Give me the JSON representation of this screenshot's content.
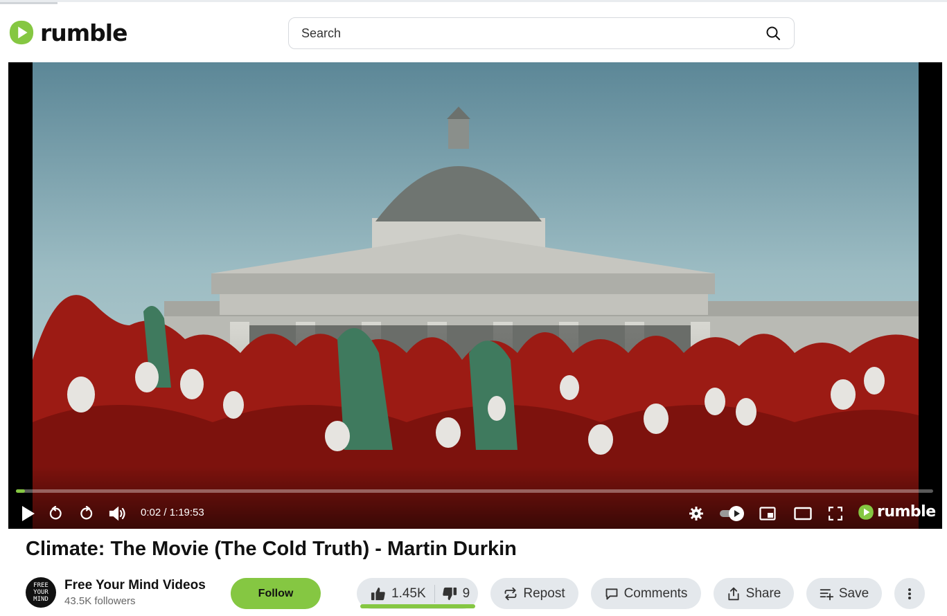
{
  "header": {
    "logo_text": "rumble",
    "search_placeholder": "Search"
  },
  "player": {
    "current_time": "0:02",
    "duration": "1:19:53",
    "time_display": "0:02 / 1:19:53",
    "progress_fraction": 0.0008,
    "logo_text": "rumble",
    "scene_description": "The National Gallery"
  },
  "video": {
    "title": "Climate: The Movie (The Cold Truth) - Martin Durkin"
  },
  "channel": {
    "avatar_text_1": "FREE",
    "avatar_text_2": "YOUR",
    "avatar_text_3": "MIND",
    "name": "Free Your Mind Videos",
    "followers": "43.5K followers",
    "follow_label": "Follow"
  },
  "actions": {
    "likes": "1.45K",
    "dislikes": "9",
    "repost_label": "Repost",
    "comments_label": "Comments",
    "share_label": "Share",
    "save_label": "Save"
  },
  "colors": {
    "brand_green": "#85c742",
    "pill_bg": "#e4e8ec"
  }
}
